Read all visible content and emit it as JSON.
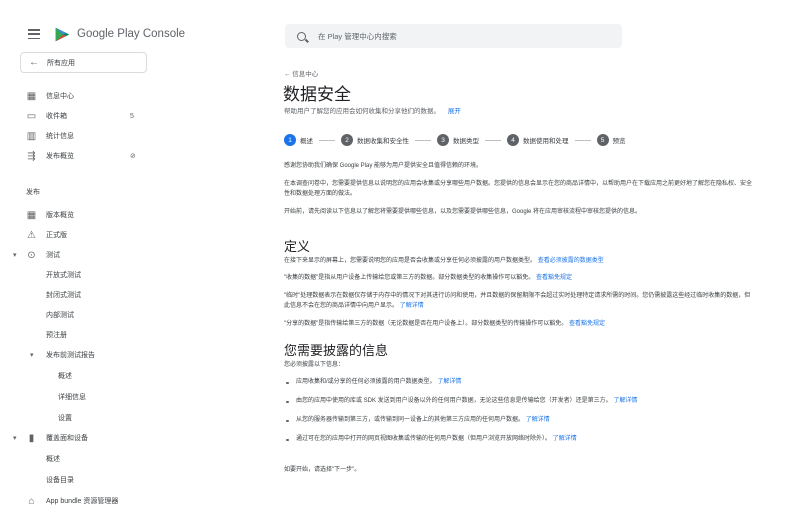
{
  "brand": {
    "name": "Google Play Console"
  },
  "sidebar": {
    "back_label": "所有应用",
    "top_items": [
      {
        "label": "信息中心",
        "count": ""
      },
      {
        "label": "收件箱",
        "count": "5"
      },
      {
        "label": "统计信息",
        "count": ""
      },
      {
        "label": "发布概览",
        "count": ""
      }
    ],
    "release_section": "发布",
    "release_items": [
      {
        "label": "版本概览"
      },
      {
        "label": "正式版"
      },
      {
        "label": "测试"
      },
      {
        "label": "开放式测试"
      },
      {
        "label": "封闭式测试"
      },
      {
        "label": "内部测试"
      },
      {
        "label": "预注册"
      },
      {
        "label": "发布前测试报告"
      },
      {
        "label": "概述"
      },
      {
        "label": "详细信息"
      },
      {
        "label": "设置"
      },
      {
        "label": "覆盖面和设备"
      },
      {
        "label": "概述"
      },
      {
        "label": "设备目录"
      },
      {
        "label": "App bundle 资源管理器"
      }
    ]
  },
  "search": {
    "placeholder": "在 Play 管理中心内搜索"
  },
  "breadcrumb": "← 信息中心",
  "page": {
    "title": "数据安全",
    "subtitle": "帮助用户了解您的应用会如何收集和分享他们的数据。",
    "subtitle_link": "展开"
  },
  "steps": [
    {
      "num": "1",
      "label": "概述"
    },
    {
      "num": "2",
      "label": "数据收集和安全性"
    },
    {
      "num": "3",
      "label": "数据类型"
    },
    {
      "num": "4",
      "label": "数据使用和处理"
    },
    {
      "num": "5",
      "label": "预览"
    }
  ],
  "intro": {
    "p1": "感谢您协助我们确保 Google Play 能够为用户提供安全且值得信赖的环境。",
    "p2": "在本调查问卷中，您需要提供信息以说明您的应用会收集或分享哪些用户数据。您提供的信息会显示在您的商品详情中，以帮助用户在下载应用之前更好地了解您在隐私权、安全性和数据处理方面的做法。",
    "p3": "开始前，请先阅读以下信息以了解您将需要提供哪些信息，以及您需要提供哪些信息，Google 将在应用审核流程中审核您提供的信息。"
  },
  "definitions": {
    "heading": "定义",
    "d1": "在接下来显示的屏幕上，您需要说明您的应用是否会收集或分享任何必须披露的用户数据类型。",
    "d1_link": "查看必须披露的数据类型",
    "d2": "\"收集的数据\"是指从用户设备上传输给您或第三方的数据。部分数据类型的收集操作可以豁免。",
    "d2_link": "查看豁免规定",
    "d3": "\"临时\"处理数据表示在数据仅存储于内存中的情况下对其进行访问和使用，并且数据的保留期限不会超过实时处理特定请求所需的时间。您仍需披露这些经过临时收集的数据，但此信息不会在您的商品详情中向用户显示。",
    "d3_link": "了解详情",
    "d4": "\"分享的数据\"是指传输给第三方的数据（无论数据是否在用户设备上）。部分数据类型的传输操作可以豁免。",
    "d4_link": "查看豁免规定"
  },
  "disclose": {
    "heading": "您需要披露的信息",
    "lead": "您必须披露以下信息：",
    "bullets": [
      {
        "text": "应用收集和/或分享的任何必须披露的用户数据类型。",
        "link": "了解详情"
      },
      {
        "text": "由您的应用中使用的库或 SDK 发送到用户设备以外的任何用户数据，无论这些信息是传输给您（开发者）还是第三方。",
        "link": "了解详情"
      },
      {
        "text": "从您的服务器传输到第三方，或传输到同一设备上的其他第三方应用的任何用户数据。",
        "link": "了解详情"
      },
      {
        "text": "通过可在您的应用中打开的网页视图收集或传输的任何用户数据（但用户浏览开放网络时除外）。",
        "link": "了解详情"
      }
    ],
    "closing": "如要开始，请选择\"下一步\"。"
  },
  "colors": {
    "accent": "#1a73e8",
    "text": "#3c4043",
    "muted": "#5f6368"
  }
}
